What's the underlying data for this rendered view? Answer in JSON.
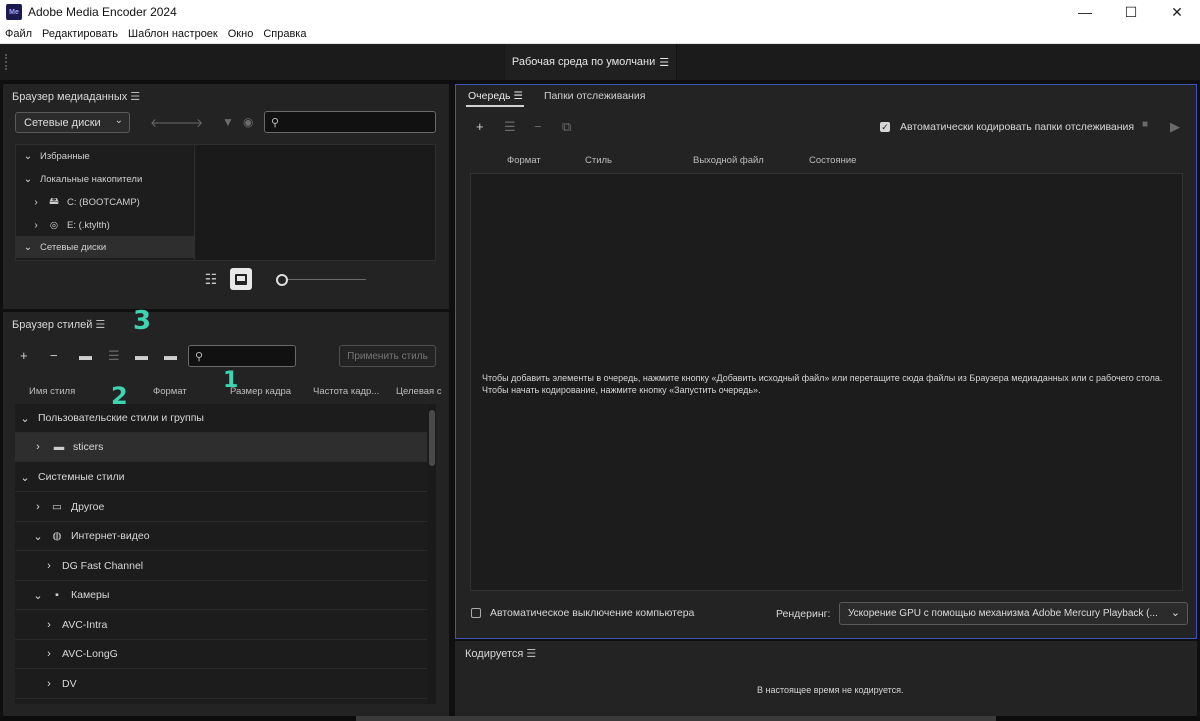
{
  "window": {
    "app_icon": "Me",
    "title": "Adobe Media Encoder 2024",
    "controls": {
      "minimize": "—",
      "maximize": "☐",
      "close": "✕"
    }
  },
  "menu": [
    "Файл",
    "Редактировать",
    "Шаблон настроек",
    "Окно",
    "Справка"
  ],
  "workspace": {
    "label": "Рабочая среда по умолчани"
  },
  "media_browser": {
    "title": "Браузер медиаданных",
    "location_dropdown": "Сетевые диски",
    "search_placeholder": "",
    "tree": [
      {
        "label": "Избранные",
        "expanded": true
      },
      {
        "label": "Локальные накопители",
        "expanded": true
      },
      {
        "label": "C: (BOOTCAMP)",
        "icon": "drive-icon"
      },
      {
        "label": "E: (.ktylth)",
        "icon": "disc-icon"
      },
      {
        "label": "Сетевые диски",
        "expanded": true
      }
    ]
  },
  "style_browser": {
    "title": "Браузер стилей",
    "apply_button": "Применить стиль",
    "columns": [
      "Имя стиля",
      "Формат",
      "Размер кадра",
      "Частота кадр...",
      "Целевая с"
    ],
    "rows": [
      {
        "label": "Пользовательские стили и группы",
        "level": 0
      },
      {
        "label": "sticers",
        "level": 1
      },
      {
        "label": "Системные стили",
        "level": 0
      },
      {
        "label": "Другое",
        "level": 1
      },
      {
        "label": "Интернет-видео",
        "level": 1
      },
      {
        "label": "DG Fast Channel",
        "level": 2
      },
      {
        "label": "Камеры",
        "level": 1
      },
      {
        "label": "AVC-Intra",
        "level": 2
      },
      {
        "label": "AVC-LongG",
        "level": 2
      },
      {
        "label": "DV",
        "level": 2
      }
    ],
    "annotations": [
      "1",
      "2",
      "3"
    ]
  },
  "queue": {
    "tabs": [
      "Очередь",
      "Папки отслеживания"
    ],
    "auto_encode_label": "Автоматически кодировать папки отслеживания",
    "auto_encode_checked": true,
    "columns": [
      "Формат",
      "Стиль",
      "Выходной файл",
      "Состояние"
    ],
    "hint": "Чтобы добавить элементы в очередь, нажмите кнопку «Добавить исходный файл» или перетащите сюда файлы из Браузера медиаданных или с рабочего стола. Чтобы начать кодирование, нажмите кнопку «Запустить очередь».",
    "shutdown_label": "Автоматическое выключение компьютера",
    "shutdown_checked": false,
    "render_label": "Рендеринг:",
    "render_value": "Ускорение GPU с помощью механизма Adobe Mercury Playback (..."
  },
  "encoding": {
    "title": "Кодируется",
    "status": "В настоящее время не кодируется."
  },
  "colors": {
    "panel": "#232323",
    "focus_border": "#3d54b8",
    "annotation": "#3dd4b0"
  }
}
